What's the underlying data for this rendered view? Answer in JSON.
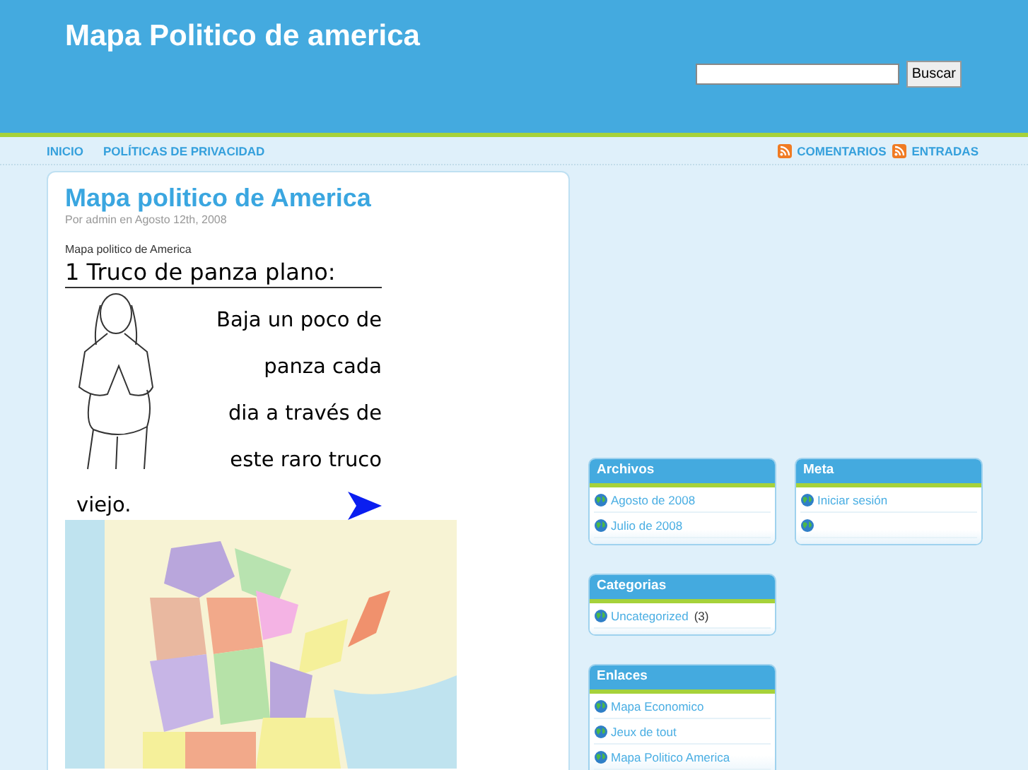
{
  "site": {
    "title": "Mapa Politico de america"
  },
  "search": {
    "button": "Buscar"
  },
  "nav": {
    "left": [
      {
        "label": "INICIO"
      },
      {
        "label": "POLÍTICAS DE PRIVACIDAD"
      }
    ],
    "right": [
      {
        "label": "COMENTARIOS"
      },
      {
        "label": "ENTRADAS"
      }
    ]
  },
  "post": {
    "title": "Mapa politico de America",
    "meta": "Por admin en Agosto 12th, 2008",
    "intro": "Mapa politico de America",
    "ad": {
      "heading": "1 Truco de panza plano:",
      "lines": [
        "Baja un poco de",
        "panza cada",
        "dia a través de",
        "este raro truco"
      ],
      "last_line": "viejo."
    }
  },
  "sidebar": [
    [
      {
        "title": "Archivos",
        "items": [
          {
            "kind": "link",
            "label": "Agosto de 2008"
          },
          {
            "kind": "link",
            "label": "Julio de 2008"
          }
        ]
      },
      {
        "title": "Categorias",
        "items": [
          {
            "kind": "link",
            "label": "Uncategorized",
            "count": "(3)"
          }
        ]
      },
      {
        "title": "Enlaces",
        "items": [
          {
            "kind": "link",
            "label": "Mapa Economico"
          },
          {
            "kind": "link",
            "label": "Jeux de tout"
          },
          {
            "kind": "link",
            "label": "Mapa Politico America"
          }
        ]
      }
    ],
    [
      {
        "title": "Meta",
        "items": [
          {
            "kind": "link",
            "label": "Iniciar sesión"
          },
          {
            "kind": "icon-only"
          }
        ]
      }
    ]
  ]
}
